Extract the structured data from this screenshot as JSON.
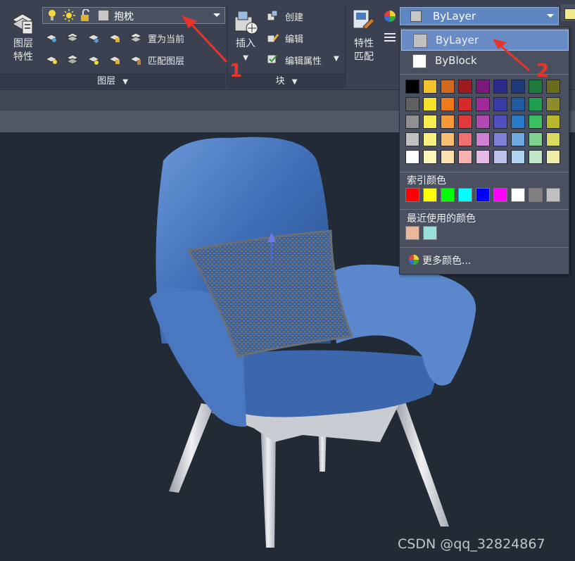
{
  "ribbon": {
    "layers_panel": {
      "big_button_line1": "图层",
      "big_button_line2": "特性",
      "layer_combo_value": "抱枕",
      "set_current_label": "置为当前",
      "match_layer_label": "匹配图层",
      "footer": "图层"
    },
    "block_panel": {
      "insert_label": "插入",
      "create_label": "创建",
      "edit_label": "编辑",
      "edit_attributes_label": "编辑属性",
      "footer": "块"
    },
    "properties_panel": {
      "match_line1": "特性",
      "match_line2": "匹配",
      "color_combo_value": "ByLayer"
    }
  },
  "color_dropdown": {
    "options": [
      {
        "label": "ByLayer",
        "swatch": "#c0c0c0",
        "selected": true
      },
      {
        "label": "ByBlock",
        "swatch": "#ffffff",
        "selected": false
      }
    ],
    "palette_rows": [
      [
        "#000000",
        "#f2c12e",
        "#d2691e",
        "#a01c1c",
        "#7a1a7a",
        "#2b2b8c",
        "#1e3a7a",
        "#1c7a3a",
        "#6b6b1e"
      ],
      [
        "#606060",
        "#f5e02a",
        "#f07a1a",
        "#d42a2a",
        "#a02a9a",
        "#3a3aa8",
        "#1e5aa0",
        "#1ea050",
        "#8c8c2a"
      ],
      [
        "#909090",
        "#f7ec50",
        "#f59a3a",
        "#e03a3a",
        "#b04ab0",
        "#5050c0",
        "#2a7ac8",
        "#3ac060",
        "#b8b82a"
      ],
      [
        "#c0c0c0",
        "#f8f080",
        "#f8c070",
        "#f07070",
        "#d080d0",
        "#8080d8",
        "#70a8e0",
        "#80d090",
        "#dada60"
      ],
      [
        "#ffffff",
        "#fbf6b8",
        "#fbe0b0",
        "#f8b0b0",
        "#e8b8e8",
        "#c0c0ec",
        "#b0d4f0",
        "#c0e8c8",
        "#eeeca8"
      ]
    ],
    "index_colors_title": "索引颜色",
    "index_colors": [
      "#ff0000",
      "#ffff00",
      "#00ff00",
      "#00ffff",
      "#0000ff",
      "#ff00ff",
      "#ffffff",
      "#808080",
      "#c0c0c0"
    ],
    "recent_colors_title": "最近使用的颜色",
    "recent_colors": [
      "#e8b89a",
      "#9ae0d8"
    ],
    "more_colors_label": "更多颜色..."
  },
  "annotations": {
    "marker1": "1",
    "marker2": "2"
  },
  "watermark": "CSDN @qq_32824867"
}
